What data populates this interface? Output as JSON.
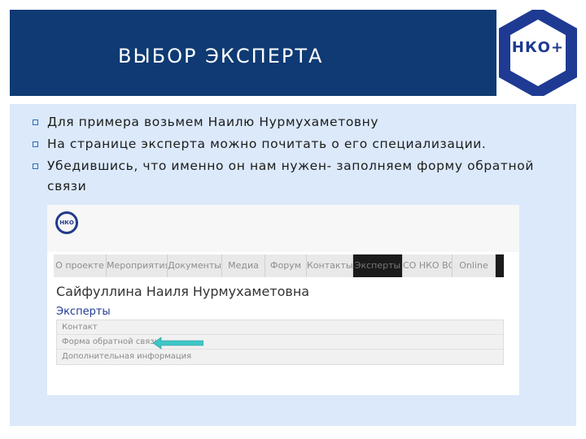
{
  "slide": {
    "title": "ВЫБОР ЭКСПЕРТА",
    "logo_text": "НКО+",
    "bullets": [
      "Для примера возьмем Наилю Нурмухаметовну",
      "На странице эксперта можно почитать о его специализации.",
      "Убедившись, что именно он нам нужен- заполняем форму обратной связи"
    ]
  },
  "screenshot": {
    "site_logo_text": "НКО",
    "nav_items": [
      "О проекте",
      "Мероприятия",
      "Документы",
      "Медиа",
      "Форум",
      "Контакты",
      "Эксперты",
      "СО НКО ВС",
      "Online"
    ],
    "active_nav": "Эксперты",
    "expert_name": "Сайфуллина Наиля Нурмухаметовна",
    "breadcrumb": "Эксперты",
    "menu_rows": [
      "Контакт",
      "Форма обратной связи",
      "Дополнительная информация"
    ],
    "arrow_color": "#3fc6c6"
  },
  "colors": {
    "header_bg": "#0f3a73",
    "panel_bg": "#dbe9fb",
    "logo_blue": "#1f3a93"
  }
}
